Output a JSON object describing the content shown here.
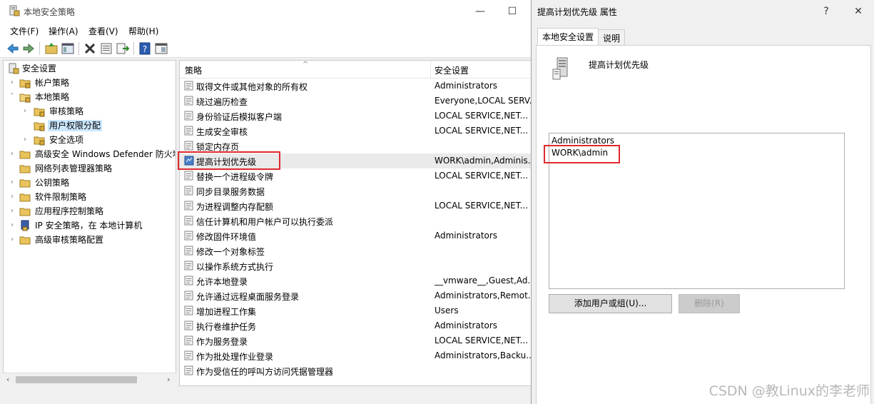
{
  "main_window": {
    "title": "本地安全策略",
    "controls": {
      "minimize": "—",
      "maximize": "☐"
    }
  },
  "menu": [
    "文件(F)",
    "操作(A)",
    "查看(V)",
    "帮助(H)"
  ],
  "toolbar_icons": [
    "back-arrow-icon",
    "forward-arrow-icon",
    "up-folder-icon",
    "show-tree-icon",
    "delete-icon",
    "properties-icon",
    "export-icon",
    "help-icon",
    "mmc-view-icon"
  ],
  "tree": {
    "items": [
      {
        "label": "安全设置",
        "level": 0,
        "expanded": true,
        "icon": "security-settings-icon"
      },
      {
        "label": "帐户策略",
        "level": 1,
        "expanded": false,
        "icon": "folder-icon"
      },
      {
        "label": "本地策略",
        "level": 1,
        "expanded": true,
        "icon": "folder-open-icon"
      },
      {
        "label": "审核策略",
        "level": 2,
        "expanded": false,
        "icon": "folder-icon"
      },
      {
        "label": "用户权限分配",
        "level": 2,
        "expanded": null,
        "icon": "folder-icon",
        "selected": true
      },
      {
        "label": "安全选项",
        "level": 2,
        "expanded": false,
        "icon": "folder-icon"
      },
      {
        "label": "高级安全 Windows Defender 防火墙",
        "level": 1,
        "expanded": false,
        "icon": "folder-icon"
      },
      {
        "label": "网络列表管理器策略",
        "level": 1,
        "expanded": null,
        "icon": "folder-icon"
      },
      {
        "label": "公钥策略",
        "level": 1,
        "expanded": false,
        "icon": "folder-icon"
      },
      {
        "label": "软件限制策略",
        "level": 1,
        "expanded": false,
        "icon": "folder-icon"
      },
      {
        "label": "应用程序控制策略",
        "level": 1,
        "expanded": false,
        "icon": "folder-icon"
      },
      {
        "label": "IP 安全策略，在 本地计算机",
        "level": 1,
        "expanded": false,
        "icon": "ip-security-icon"
      },
      {
        "label": "高级审核策略配置",
        "level": 1,
        "expanded": false,
        "icon": "folder-icon"
      }
    ]
  },
  "list": {
    "columns": {
      "policy": "策略",
      "setting": "安全设置"
    },
    "rows": [
      {
        "policy": "取得文件或其他对象的所有权",
        "setting": "Administrators"
      },
      {
        "policy": "绕过遍历检查",
        "setting": "Everyone,LOCAL SERV..."
      },
      {
        "policy": "身份验证后模拟客户端",
        "setting": "LOCAL SERVICE,NET..."
      },
      {
        "policy": "生成安全审核",
        "setting": "LOCAL SERVICE,NET..."
      },
      {
        "policy": "锁定内存页",
        "setting": ""
      },
      {
        "policy": "提高计划优先级",
        "setting": "WORK\\admin,Adminis...",
        "highlight": true
      },
      {
        "policy": "替换一个进程级令牌",
        "setting": "LOCAL SERVICE,NET..."
      },
      {
        "policy": "同步目录服务数据",
        "setting": ""
      },
      {
        "policy": "为进程调整内存配额",
        "setting": "LOCAL SERVICE,NET..."
      },
      {
        "policy": "信任计算机和用户帐户可以执行委派",
        "setting": ""
      },
      {
        "policy": "修改固件环境值",
        "setting": "Administrators"
      },
      {
        "policy": "修改一个对象标签",
        "setting": ""
      },
      {
        "policy": "以操作系统方式执行",
        "setting": ""
      },
      {
        "policy": "允许本地登录",
        "setting": "__vmware__,Guest,Ad..."
      },
      {
        "policy": "允许通过远程桌面服务登录",
        "setting": "Administrators,Remot..."
      },
      {
        "policy": "增加进程工作集",
        "setting": "Users"
      },
      {
        "policy": "执行卷维护任务",
        "setting": "Administrators"
      },
      {
        "policy": "作为服务登录",
        "setting": "LOCAL SERVICE,NET..."
      },
      {
        "policy": "作为批处理作业登录",
        "setting": "Administrators,Backu..."
      },
      {
        "policy": "作为受信任的呼叫方访问凭据管理器",
        "setting": ""
      }
    ]
  },
  "dialog": {
    "title": "提高计划优先级 属性",
    "controls": {
      "help": "?",
      "close": "✕"
    },
    "tabs": [
      "本地安全设置",
      "说明"
    ],
    "policy_name": "提高计划优先级",
    "members": [
      "Administrators",
      "WORK\\admin"
    ],
    "add_button": "添加用户或组(U)...",
    "remove_button": "删除(R)"
  },
  "watermark": "CSDN @教Linux的李老师",
  "colors": {
    "selection": "#cce8ff",
    "highlight_row": "#eaeaea",
    "annotation_red": "#e0292e"
  }
}
